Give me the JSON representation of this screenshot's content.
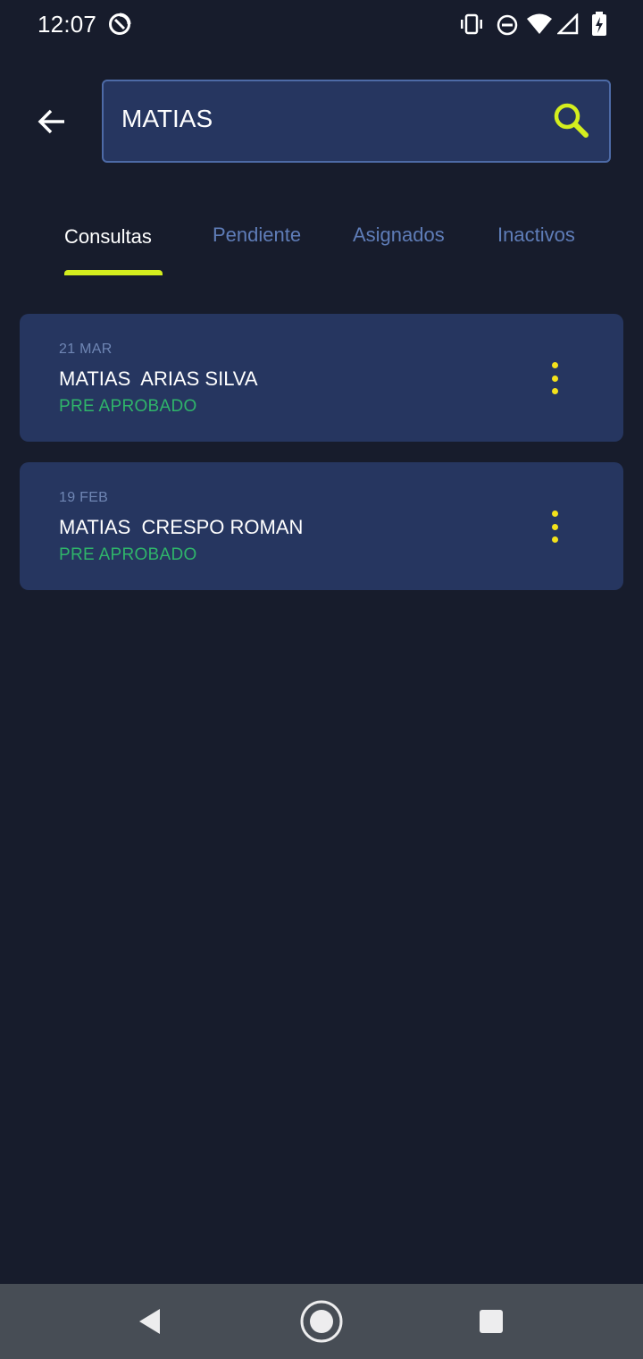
{
  "status_bar": {
    "time": "12:07",
    "icons": [
      "sync-icon",
      "vibrate-icon",
      "do-not-disturb-icon",
      "wifi-icon",
      "signal-icon",
      "battery-charging-icon"
    ]
  },
  "search": {
    "value": "MATIAS",
    "placeholder": "",
    "accent_color": "#d4ee1e"
  },
  "tabs": [
    {
      "label": "Consultas",
      "active": true
    },
    {
      "label": "Pendiente",
      "active": false
    },
    {
      "label": "Asignados",
      "active": false
    },
    {
      "label": "Inactivos",
      "active": false
    }
  ],
  "results": [
    {
      "date": "21 MAR",
      "name": "MATIAS  ARIAS SILVA",
      "status": "PRE APROBADO"
    },
    {
      "date": "19 FEB",
      "name": "MATIAS  CRESPO ROMAN",
      "status": "PRE APROBADO"
    }
  ],
  "colors": {
    "background": "#171c2c",
    "card": "#263660",
    "status_ok": "#2fb56a",
    "menu_dots": "#f3e21b",
    "tab_inactive": "#5f7db8"
  },
  "nav": [
    "back-nav-icon",
    "home-nav-icon",
    "recents-nav-icon"
  ]
}
